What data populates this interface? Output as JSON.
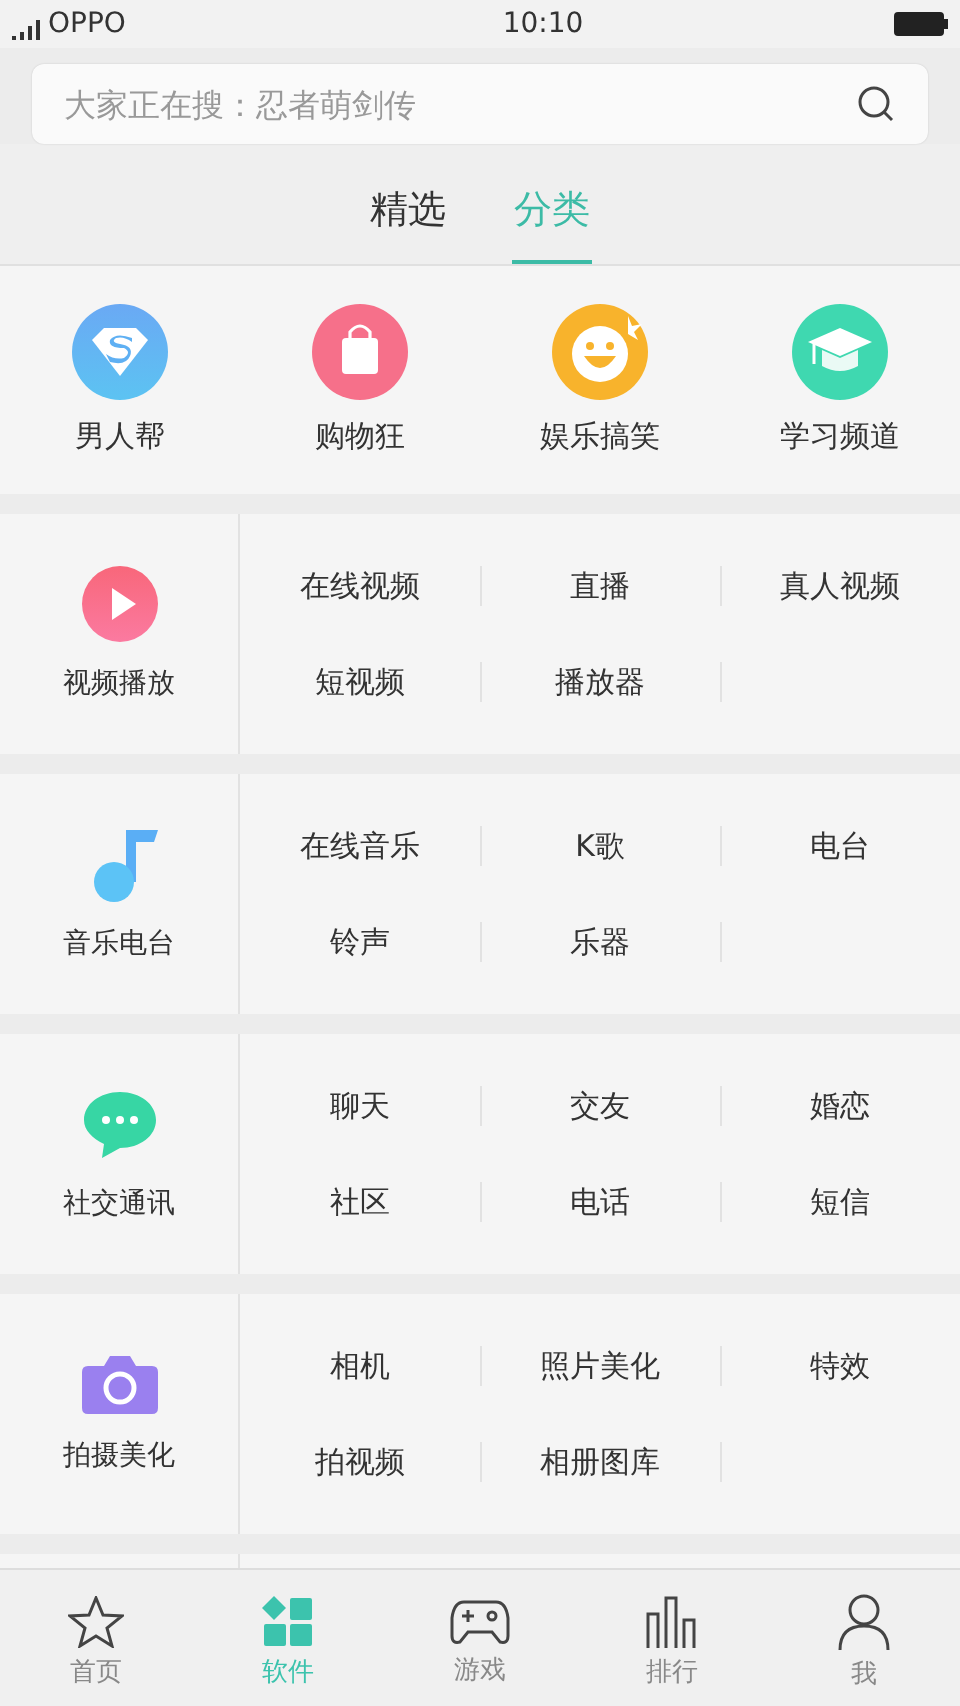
{
  "status_bar": {
    "carrier": "OPPO",
    "time": "10:10"
  },
  "search": {
    "placeholder": "大家正在搜：忍者萌剑传"
  },
  "tabs": [
    {
      "label": "精选",
      "selected": false
    },
    {
      "label": "分类",
      "selected": true
    }
  ],
  "featured": [
    {
      "label": "男人帮",
      "kind": "hero"
    },
    {
      "label": "购物狂",
      "kind": "bag"
    },
    {
      "label": "娱乐搞笑",
      "kind": "smile"
    },
    {
      "label": "学习频道",
      "kind": "cap"
    }
  ],
  "sections": [
    {
      "name": "视频播放",
      "kind": "play",
      "items": [
        "在线视频",
        "直播",
        "真人视频",
        "短视频",
        "播放器"
      ]
    },
    {
      "name": "音乐电台",
      "kind": "music",
      "items": [
        "在线音乐",
        "K歌",
        "电台",
        "铃声",
        "乐器"
      ]
    },
    {
      "name": "社交通讯",
      "kind": "chat",
      "items": [
        "聊天",
        "交友",
        "婚恋",
        "社区",
        "电话",
        "短信"
      ]
    },
    {
      "name": "拍摄美化",
      "kind": "camera",
      "items": [
        "相机",
        "照片美化",
        "特效",
        "拍视频",
        "相册图库"
      ]
    }
  ],
  "bottom_nav": [
    {
      "label": "首页",
      "kind": "star",
      "selected": false
    },
    {
      "label": "软件",
      "kind": "apps",
      "selected": true
    },
    {
      "label": "游戏",
      "kind": "gamepad",
      "selected": false
    },
    {
      "label": "排行",
      "kind": "chart",
      "selected": false
    },
    {
      "label": "我",
      "kind": "person",
      "selected": false
    }
  ]
}
